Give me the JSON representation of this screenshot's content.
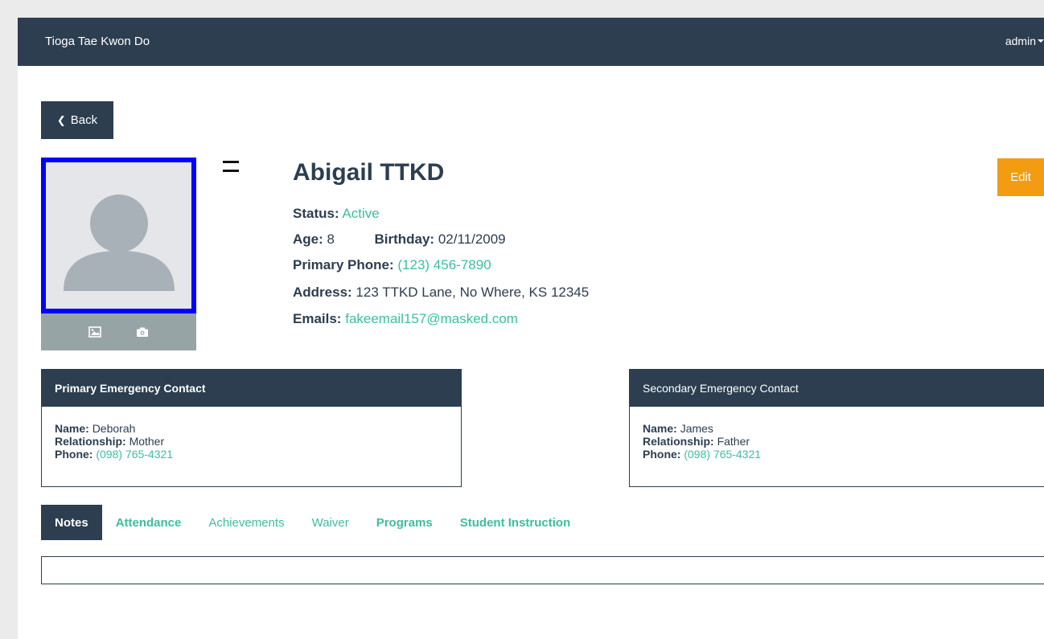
{
  "navbar": {
    "brand": "Tioga Tae Kwon Do",
    "user": "admin"
  },
  "back_button": {
    "label": "Back"
  },
  "student": {
    "name": "Abigail TTKD",
    "status_label": "Status:",
    "status": "Active",
    "age_label": "Age:",
    "age": "8",
    "birthday_label": "Birthday:",
    "birthday": "02/11/2009",
    "phone_label": "Primary Phone:",
    "phone": "(123) 456-7890",
    "address_label": "Address:",
    "address": "123 TTKD Lane, No Where, KS 12345",
    "emails_label": "Emails:",
    "email": "fakeemail157@masked.com"
  },
  "edit_button": {
    "label": "Edit"
  },
  "primary_contact": {
    "title": "Primary Emergency Contact",
    "name_label": "Name:",
    "name": "Deborah",
    "relationship_label": "Relationship:",
    "relationship": "Mother",
    "phone_label": "Phone:",
    "phone": "(098) 765-4321"
  },
  "secondary_contact": {
    "title": "Secondary Emergency Contact",
    "name_label": "Name:",
    "name": "James",
    "relationship_label": "Relationship:",
    "relationship": "Father",
    "phone_label": "Phone:",
    "phone": "(098) 765-4321"
  },
  "tabs": [
    {
      "label": "Notes"
    },
    {
      "label": "Attendance"
    },
    {
      "label": "Achievements"
    },
    {
      "label": "Waiver"
    },
    {
      "label": "Programs"
    },
    {
      "label": "Student Instruction"
    }
  ],
  "colors": {
    "navy": "#2c3e50",
    "teal": "#3bbf9f",
    "orange": "#f39c12",
    "photo_border": "#0000ff"
  }
}
